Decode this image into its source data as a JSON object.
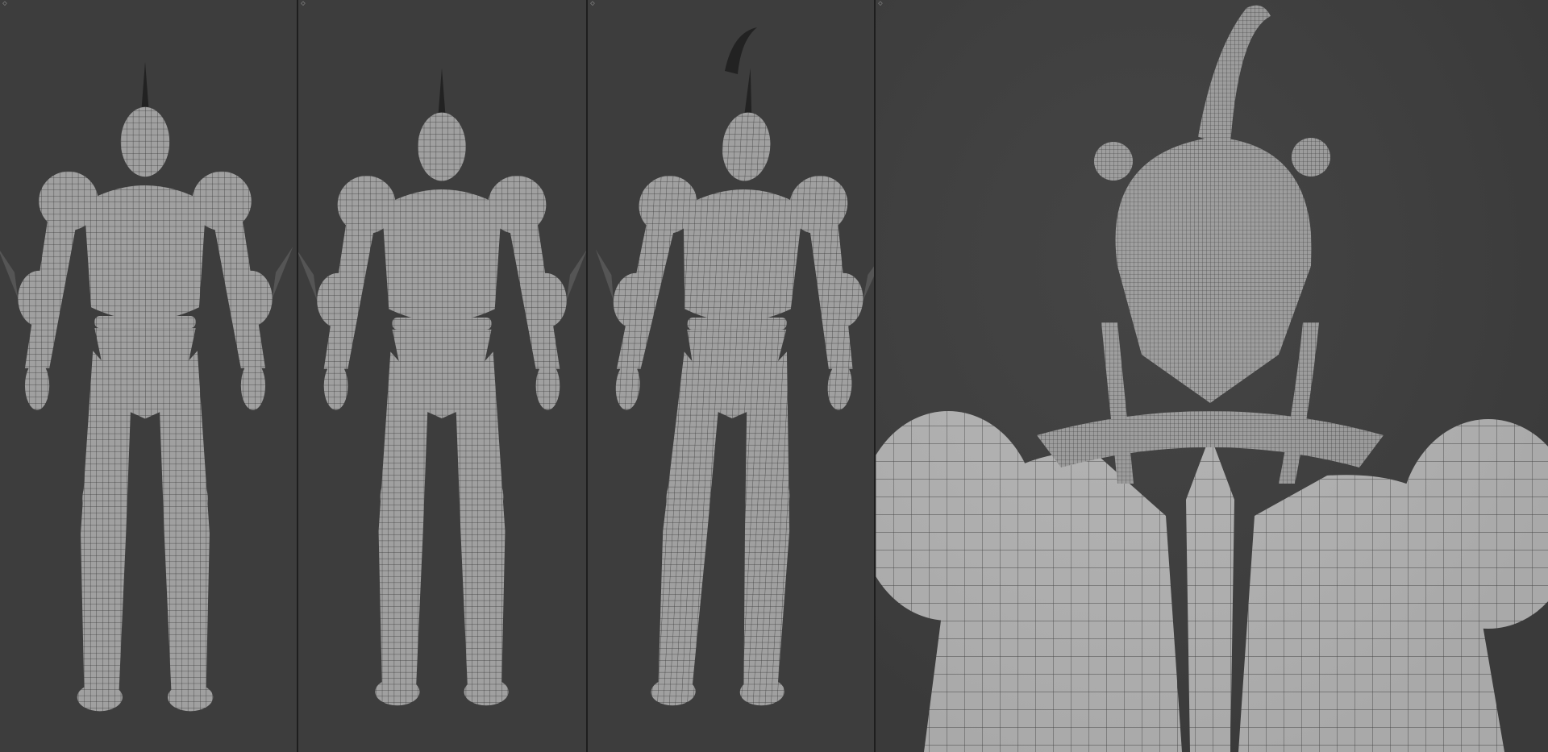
{
  "app": {
    "bg_color": "#3d3d3d",
    "divider_color": "#1e1e1e"
  },
  "viewports": [
    {
      "view": "front",
      "corner_widget": "◇"
    },
    {
      "view": "back",
      "corner_widget": "◇"
    },
    {
      "view": "three-quarter",
      "corner_widget": "◇"
    },
    {
      "view": "close-up-head",
      "corner_widget": "◇"
    }
  ],
  "mesh": {
    "fill_color": "#9a9a9a",
    "shade_color": "#6f6f6f",
    "wire_color": "#2a2a2a"
  },
  "icons": {
    "corner_widget": "area-split-icon"
  }
}
